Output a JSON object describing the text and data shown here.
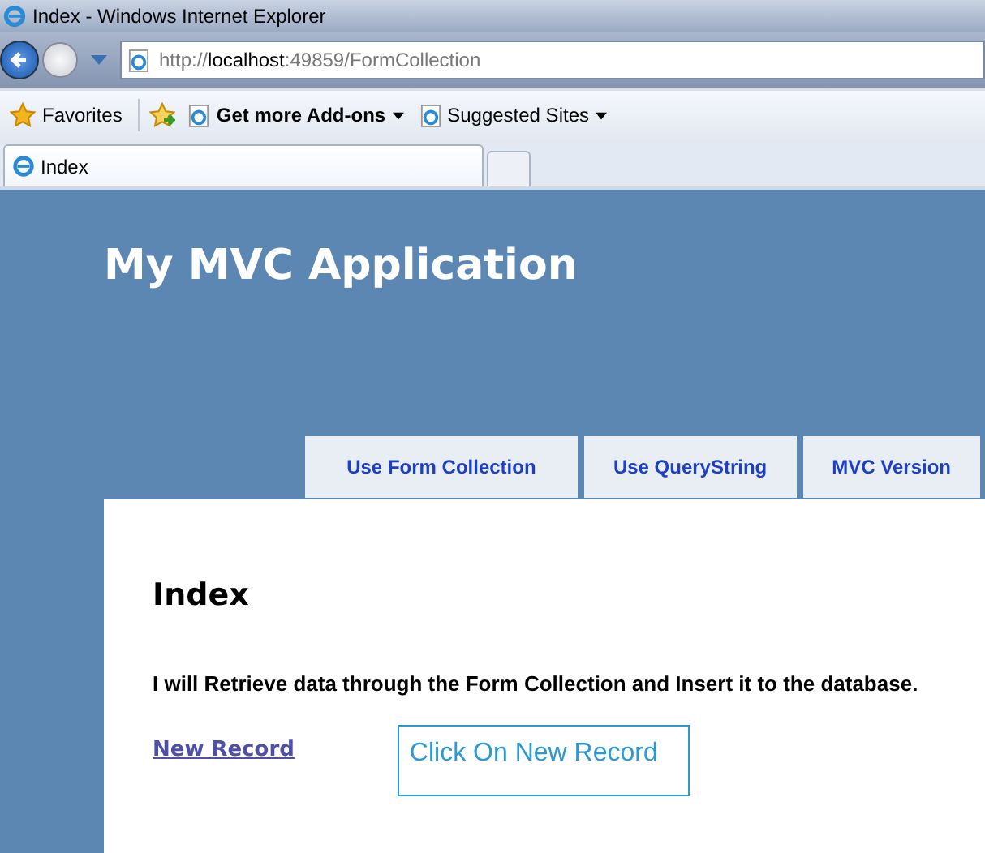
{
  "window": {
    "title": "Index - Windows Internet Explorer"
  },
  "address_bar": {
    "url_prefix": "http://",
    "url_host": "localhost",
    "url_rest": ":49859/FormCollection"
  },
  "favorites_bar": {
    "favorites": "Favorites",
    "items": [
      {
        "label": "Get more Add-ons",
        "bold": true
      },
      {
        "label": "Suggested Sites",
        "bold": false
      }
    ]
  },
  "browser_tabs": [
    {
      "label": "Index",
      "selected": true
    }
  ],
  "page": {
    "site_title": "My MVC Application",
    "menu": [
      {
        "label": "Use Form Collection"
      },
      {
        "label": "Use QueryString"
      },
      {
        "label": "MVC Version"
      }
    ],
    "heading": "Index",
    "description": "I will Retrieve data through the Form Collection and Insert it to the database.",
    "link": "New Record",
    "callout": "Click On New Record"
  }
}
